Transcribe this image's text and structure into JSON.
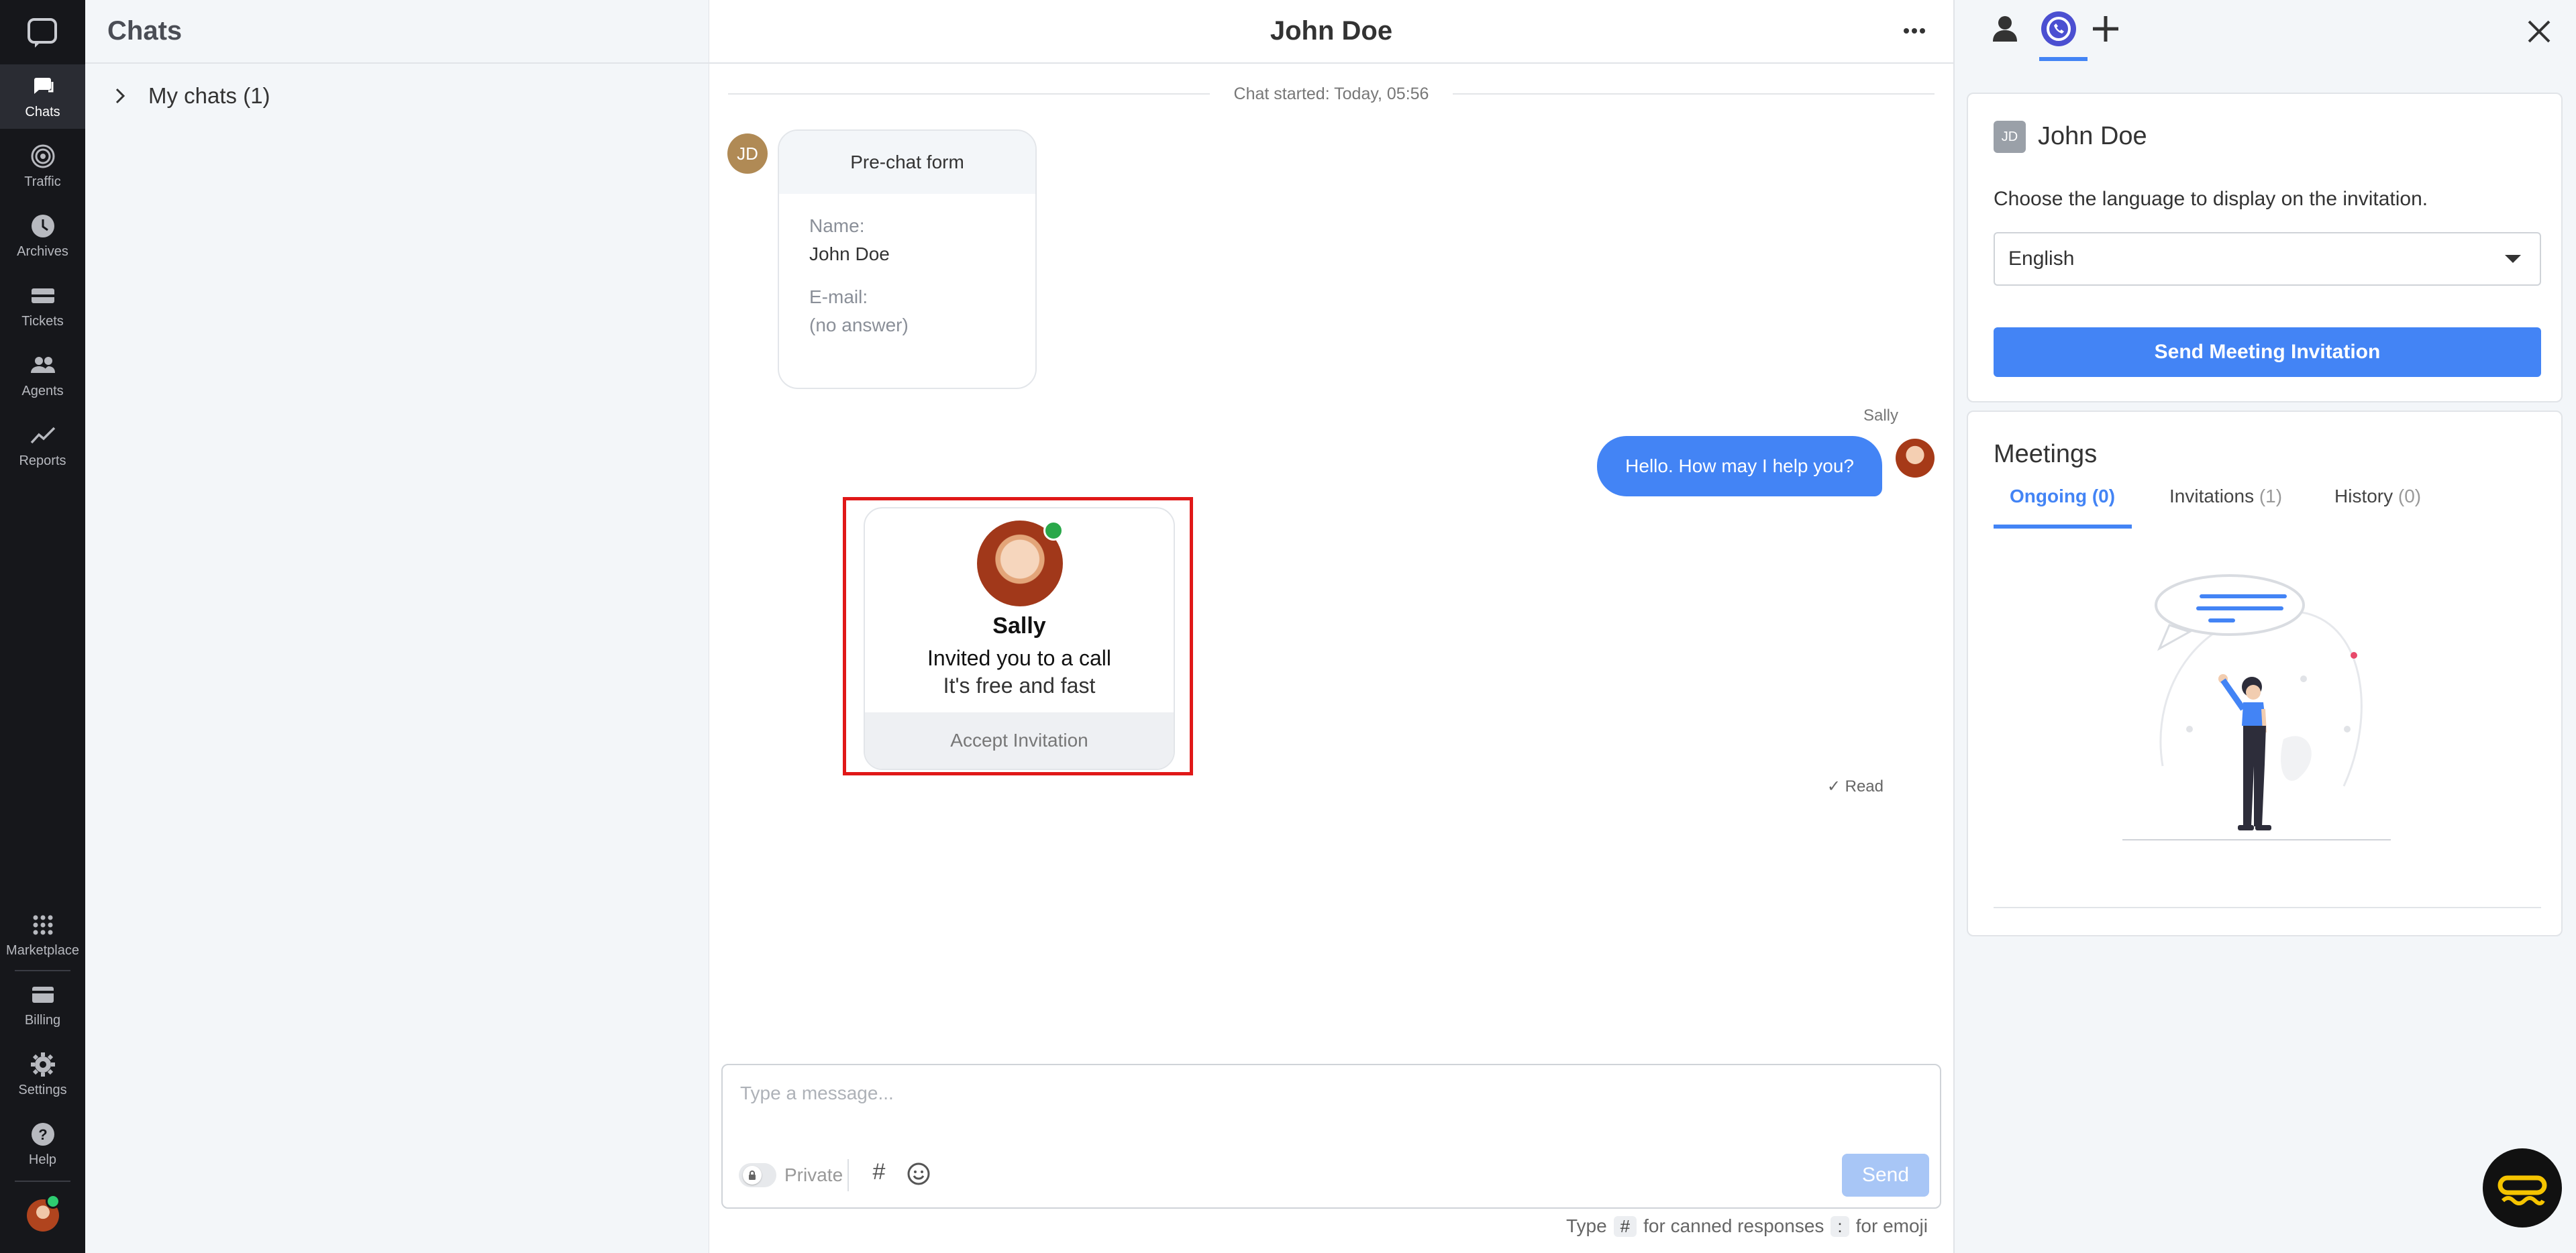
{
  "rail": {
    "items": [
      {
        "label": "Chats",
        "icon": "chat-icon"
      },
      {
        "label": "Traffic",
        "icon": "traffic-icon"
      },
      {
        "label": "Archives",
        "icon": "clock-icon"
      },
      {
        "label": "Tickets",
        "icon": "ticket-icon"
      },
      {
        "label": "Agents",
        "icon": "agents-icon"
      },
      {
        "label": "Reports",
        "icon": "chart-line-icon"
      }
    ],
    "bottom_items": [
      {
        "label": "Marketplace",
        "icon": "grid-icon"
      },
      {
        "label": "Billing",
        "icon": "billing-icon"
      },
      {
        "label": "Settings",
        "icon": "gear-icon"
      },
      {
        "label": "Help",
        "icon": "help-icon"
      }
    ]
  },
  "chatlist": {
    "title": "Chats",
    "group_label": "My chats (1)"
  },
  "conversation": {
    "title": "John Doe",
    "started": "Chat started: Today, 05:56",
    "visitor_initials": "JD",
    "prechat": {
      "title": "Pre-chat form",
      "name_label": "Name:",
      "name_value": "John Doe",
      "email_label": "E-mail:",
      "email_value": "(no answer)"
    },
    "agent_name": "Sally",
    "agent_message": "Hello. How may I help you?",
    "invite_card": {
      "name": "Sally",
      "line1": "Invited you to a call",
      "line2": "It's free and fast",
      "accept_label": "Accept Invitation"
    },
    "read_status": "✓ Read",
    "composer": {
      "placeholder": "Type a message...",
      "private_label": "Private",
      "hash_label": "#",
      "send_label": "Send",
      "hint_type": "Type",
      "hint_key1": "#",
      "hint_canned": "for canned responses",
      "hint_key2": ":",
      "hint_emoji": "for emoji"
    }
  },
  "right_panel": {
    "visitor_initials": "JD",
    "visitor_name": "John Doe",
    "language_prompt": "Choose the language to display on the invitation.",
    "language_selected": "English",
    "send_invitation_label": "Send Meeting Invitation",
    "meetings_title": "Meetings",
    "tabs": [
      {
        "label": "Ongoing",
        "count": "(0)"
      },
      {
        "label": "Invitations",
        "count": "(1)"
      },
      {
        "label": "History",
        "count": "(0)"
      }
    ]
  },
  "colors": {
    "accent": "#4384f5",
    "rail_bg": "#16171b",
    "highlight": "#e01818"
  }
}
